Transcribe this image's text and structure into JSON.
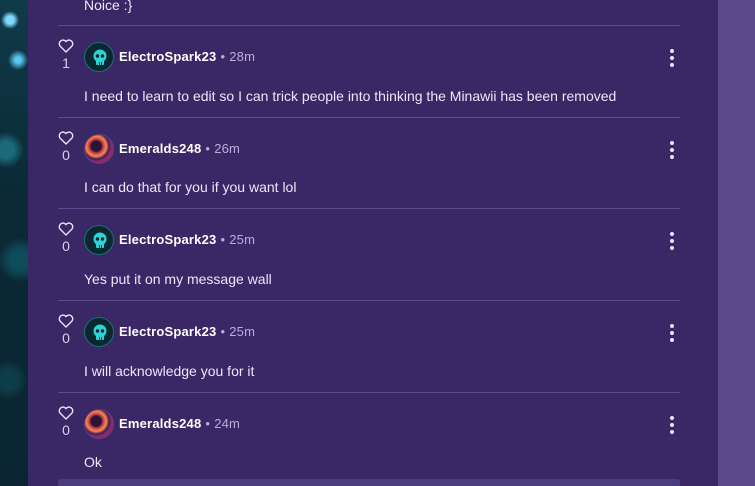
{
  "previous_comment_text": "Noice :}",
  "separator_dot": "•",
  "comments": [
    {
      "likes": "1",
      "author": "ElectroSpark23",
      "time": "28m",
      "avatar": "skull-avatar",
      "text": "I need to learn to edit so I can trick people into thinking the Minawii has been removed"
    },
    {
      "likes": "0",
      "author": "Emeralds248",
      "time": "26m",
      "avatar": "swirl-avatar",
      "text": "I can do that for you if you want lol"
    },
    {
      "likes": "0",
      "author": "ElectroSpark23",
      "time": "25m",
      "avatar": "skull-avatar",
      "text": "Yes put it on my message wall"
    },
    {
      "likes": "0",
      "author": "ElectroSpark23",
      "time": "25m",
      "avatar": "skull-avatar",
      "text": "I will acknowledge you for it"
    },
    {
      "likes": "0",
      "author": "Emeralds248",
      "time": "24m",
      "avatar": "swirl-avatar",
      "text": "Ok"
    }
  ],
  "icons": {
    "like": "heart-outline-icon",
    "more": "more-options-icon"
  },
  "colors": {
    "panel": "#3a2866",
    "rail": "#5a4a8c",
    "divider": "#5c4c8e",
    "accent_skull": "#2fd3d6"
  }
}
